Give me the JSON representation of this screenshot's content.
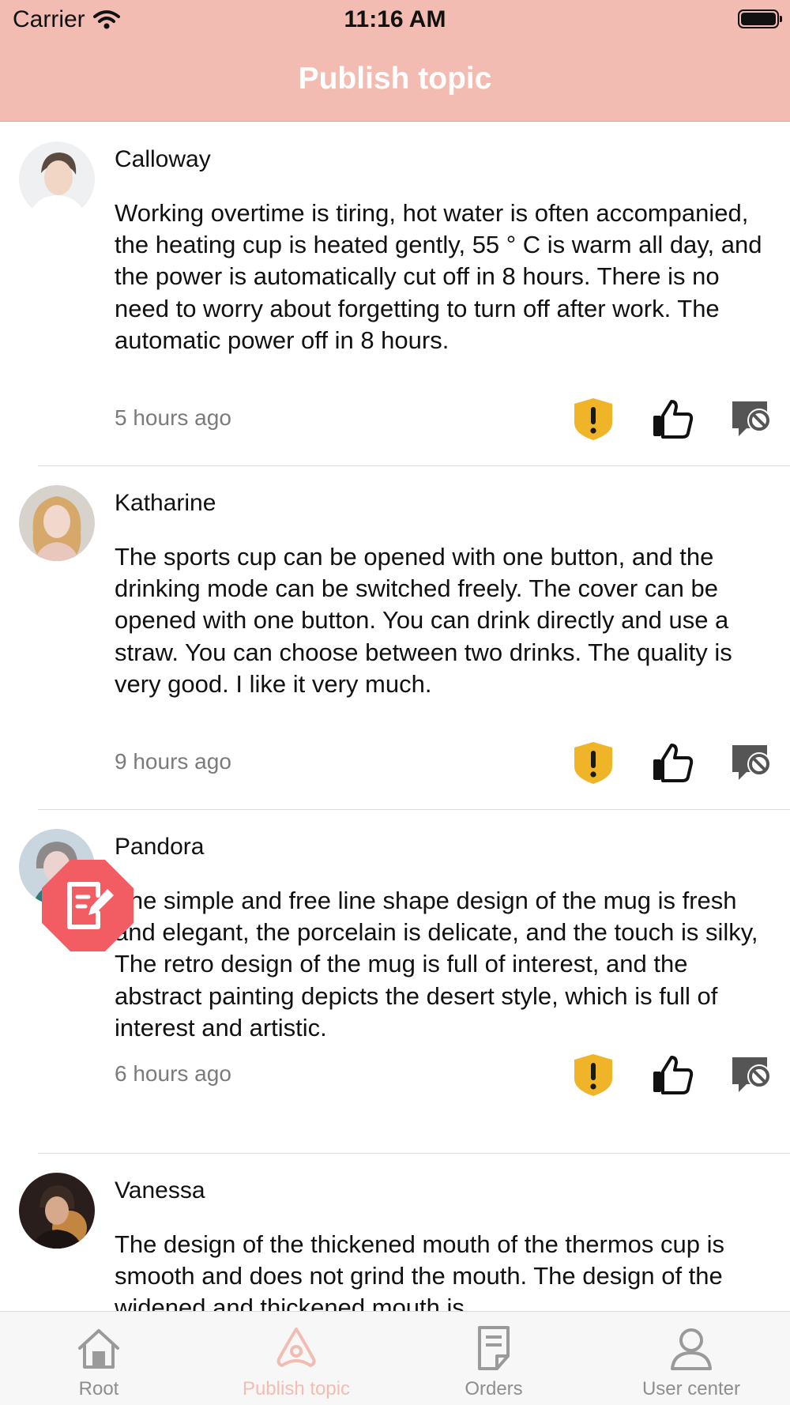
{
  "status_bar": {
    "carrier": "Carrier",
    "time": "11:16 AM"
  },
  "header": {
    "title": "Publish topic"
  },
  "colors": {
    "header_bg": "#f2bcb3",
    "report_icon": "#f0b429",
    "fab_bg": "#f25c63",
    "active_tab": "#f2bcb3",
    "inactive_tab": "#8e8e8e"
  },
  "posts": [
    {
      "author": "Calloway",
      "text": "Working overtime is tiring, hot water is often accompanied, the heating cup is heated gently, 55 ° C is warm all day, and the power is automatically cut off in 8 hours. There is no need to worry about forgetting to turn off after work. The automatic power off in 8 hours.",
      "time": "5 hours ago"
    },
    {
      "author": "Katharine",
      "text": "The sports cup can be opened with one button, and the drinking mode can be switched freely. The cover can be opened with one button. You can drink directly and use a straw. You can choose between two drinks. The quality is very good. I like it very much.",
      "time": "9 hours ago"
    },
    {
      "author": "Pandora",
      "text": "The simple and free line shape design of the mug is fresh and elegant, the porcelain is delicate, and the touch is silky,   The retro design of the mug is full of interest, and the abstract painting depicts the desert style, which is full of interest and artistic.",
      "time": "6 hours ago"
    },
    {
      "author": "Vanessa",
      "text": "The design of the thickened mouth of the thermos cup is smooth and does not grind the mouth. The design of the widened and thickened mouth is"
    }
  ],
  "post_actions": [
    "report-icon",
    "thumbs-up-icon",
    "block-icon"
  ],
  "tabbar": {
    "tabs": [
      {
        "label": "Root",
        "icon": "house-icon",
        "active": false
      },
      {
        "label": "Publish topic",
        "icon": "publish-icon",
        "active": true
      },
      {
        "label": "Orders",
        "icon": "orders-icon",
        "active": false
      },
      {
        "label": "User center",
        "icon": "user-icon",
        "active": false
      }
    ]
  },
  "fab": {
    "icon": "compose-icon"
  }
}
